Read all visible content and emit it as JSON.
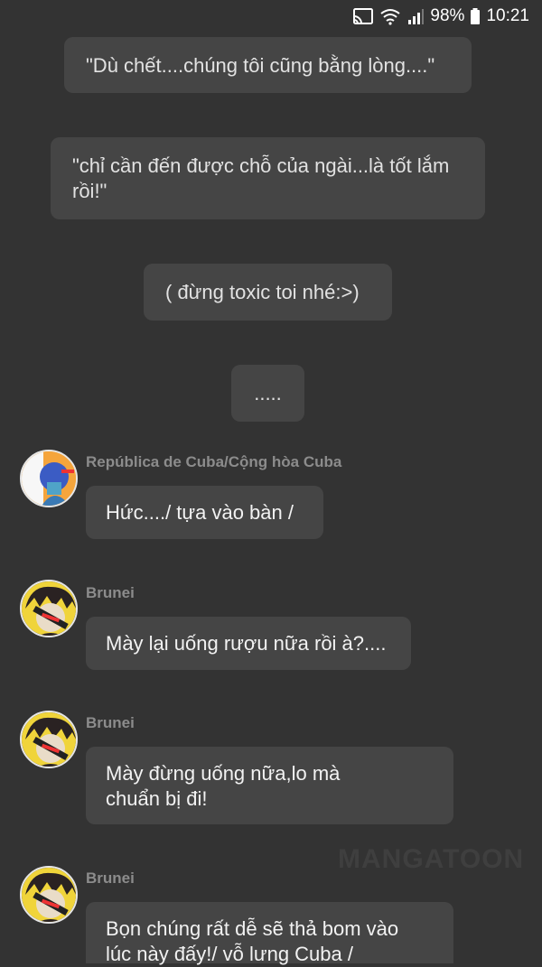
{
  "status_bar": {
    "battery": "98%",
    "time": "10:21",
    "icons": [
      "cast-icon",
      "wifi-icon",
      "signal-icon",
      "battery-icon"
    ]
  },
  "narration": [
    "\"Dù chết....chúng tôi cũng bằng lòng....\"",
    "\"chỉ cần đến được chỗ của ngài...là tốt lắm rồi!\"",
    "( đừng toxic toi nhé:>)",
    "....."
  ],
  "messages": [
    {
      "sender": "República de Cuba/Cộng hòa Cuba",
      "text": "Hức..../ tựa vào bàn /"
    },
    {
      "sender": "Brunei",
      "text": "Mày lại uống rượu nữa rồi à?...."
    },
    {
      "sender": "Brunei",
      "text": "Mày đừng uống nữa,lo mà chuẩn bị đi!"
    },
    {
      "sender": "Brunei",
      "text": "Bọn chúng rất dễ sẽ thả bom vào lúc này đấy!/ vỗ lưng Cuba /"
    }
  ],
  "watermark": "MANGATOON",
  "colors": {
    "background": "#333333",
    "bubble": "#454545",
    "sender_name": "#8c8c8c"
  }
}
